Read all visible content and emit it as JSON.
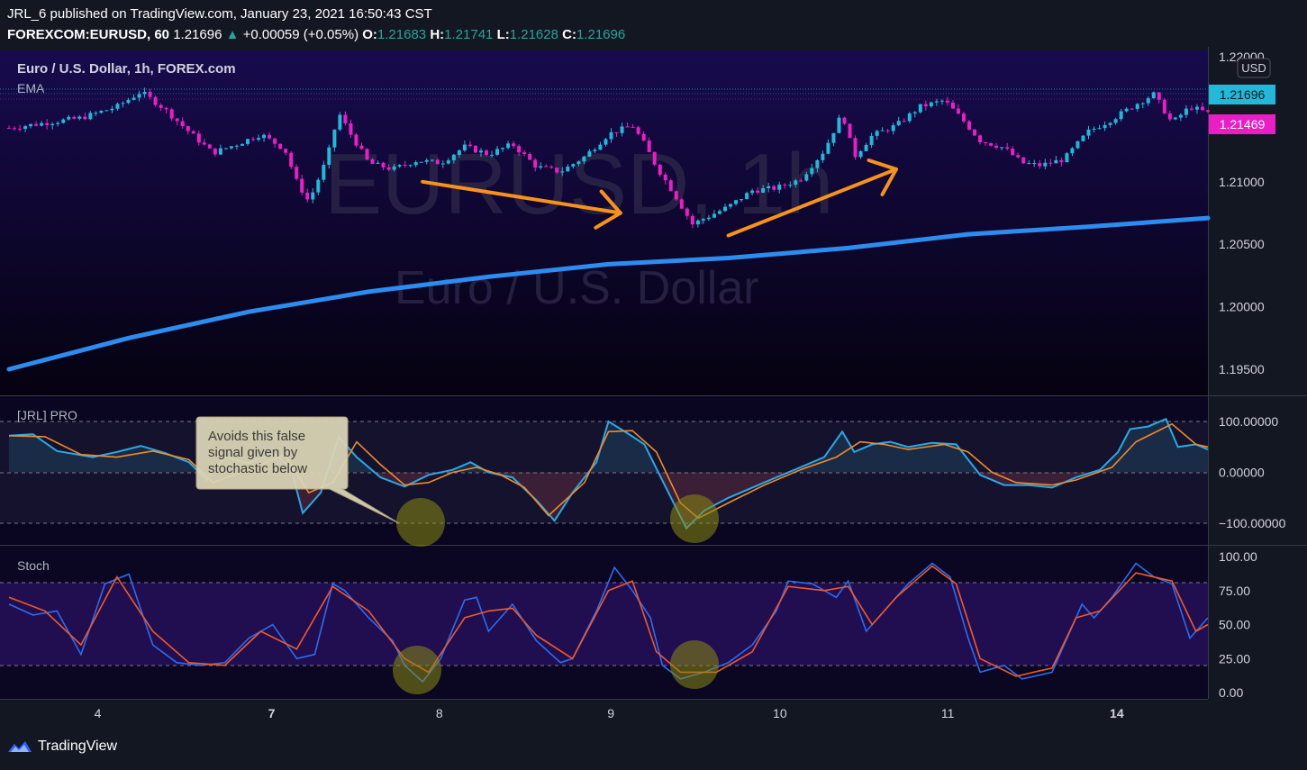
{
  "header": {
    "published_line": "JRL_6 published on TradingView.com, January 23, 2021 16:50:43 CST",
    "symbol": "FOREXCOM:EURUSD, 60",
    "last": "1.21696",
    "change": "+0.00059 (+0.05%)",
    "o_label": "O:",
    "o_val": "1.21683",
    "h_label": "H:",
    "h_val": "1.21741",
    "l_label": "L:",
    "l_val": "1.21628",
    "c_label": "C:",
    "c_val": "1.21696"
  },
  "colors": {
    "bg_dark": "#07051f",
    "bull": "#22b8d8",
    "bear": "#e91ec4",
    "ema": "#2d8cf0",
    "arrow": "#f7931a",
    "osc_fast": "#2aa9e6",
    "osc_slow": "#f28a2a",
    "stoch_k": "#2b6cf0",
    "stoch_d": "#f05a28"
  },
  "main_pane": {
    "title": "Euro / U.S. Dollar, 1h, FOREX.com",
    "indicator": "EMA",
    "watermark_big": "EURUSD, 1h",
    "watermark_small": "Euro / U.S. Dollar",
    "currency_button": "USD",
    "price_ticks": [
      "1.22000",
      "1.21000",
      "1.20500",
      "1.20000",
      "1.19500"
    ],
    "badge_current": "1.21696",
    "badge_marker": "1.21469"
  },
  "jrl_pane": {
    "title": "[JRL] PRO",
    "ticks": [
      "100.00000",
      "0.00000",
      "−100.00000"
    ],
    "callout": "Avoids this false signal given by stochastic below"
  },
  "stoch_pane": {
    "title": "Stoch",
    "ticks": [
      "100.00",
      "75.00",
      "50.00",
      "25.00",
      "0.00"
    ]
  },
  "time_axis": [
    "4",
    "7",
    "8",
    "9",
    "10",
    "11",
    "14"
  ],
  "footer": {
    "brand": "TradingView"
  },
  "chart_data": [
    {
      "type": "candlestick",
      "title": "Euro / U.S. Dollar, 1h, FOREX.com",
      "ylim": [
        1.1925,
        1.2205
      ],
      "x_labels": [
        "4",
        "7",
        "8",
        "9",
        "10",
        "11",
        "14"
      ],
      "price_path": [
        [
          0,
          1.2143
        ],
        [
          0.03,
          1.2147
        ],
        [
          0.06,
          1.2151
        ],
        [
          0.09,
          1.216
        ],
        [
          0.11,
          1.2172
        ],
        [
          0.13,
          1.2158
        ],
        [
          0.15,
          1.214
        ],
        [
          0.17,
          1.2123
        ],
        [
          0.19,
          1.213
        ],
        [
          0.21,
          1.2138
        ],
        [
          0.23,
          1.2126
        ],
        [
          0.24,
          1.21
        ],
        [
          0.25,
          1.2084
        ],
        [
          0.265,
          1.2118
        ],
        [
          0.275,
          1.2155
        ],
        [
          0.285,
          1.2138
        ],
        [
          0.3,
          1.2115
        ],
        [
          0.32,
          1.211
        ],
        [
          0.34,
          1.2117
        ],
        [
          0.36,
          1.2115
        ],
        [
          0.38,
          1.2128
        ],
        [
          0.4,
          1.2122
        ],
        [
          0.42,
          1.213
        ],
        [
          0.44,
          1.2112
        ],
        [
          0.46,
          1.2108
        ],
        [
          0.48,
          1.212
        ],
        [
          0.5,
          1.2138
        ],
        [
          0.52,
          1.2145
        ],
        [
          0.53,
          1.213
        ],
        [
          0.54,
          1.2112
        ],
        [
          0.555,
          1.209
        ],
        [
          0.57,
          1.2066
        ],
        [
          0.585,
          1.2073
        ],
        [
          0.6,
          1.208
        ],
        [
          0.62,
          1.2093
        ],
        [
          0.64,
          1.2095
        ],
        [
          0.66,
          1.2102
        ],
        [
          0.68,
          1.2125
        ],
        [
          0.695,
          1.2155
        ],
        [
          0.705,
          1.212
        ],
        [
          0.72,
          1.2137
        ],
        [
          0.74,
          1.2145
        ],
        [
          0.76,
          1.216
        ],
        [
          0.78,
          1.2165
        ],
        [
          0.795,
          1.215
        ],
        [
          0.81,
          1.2133
        ],
        [
          0.83,
          1.2127
        ],
        [
          0.845,
          1.2115
        ],
        [
          0.86,
          1.2113
        ],
        [
          0.88,
          1.2118
        ],
        [
          0.9,
          1.214
        ],
        [
          0.92,
          1.215
        ],
        [
          0.94,
          1.2162
        ],
        [
          0.955,
          1.217
        ],
        [
          0.97,
          1.2147
        ],
        [
          0.985,
          1.216
        ],
        [
          1,
          1.2155
        ]
      ],
      "annotation_arrow_1": {
        "from": [
          0.345,
          1.21
        ],
        "to": [
          0.51,
          1.2075
        ]
      },
      "annotation_arrow_2": {
        "from": [
          0.6,
          1.2057
        ],
        "to": [
          0.74,
          1.211
        ]
      }
    },
    {
      "type": "line",
      "name": "EMA",
      "ylim": [
        1.1925,
        1.2205
      ],
      "x": [
        0,
        0.1,
        0.2,
        0.3,
        0.4,
        0.5,
        0.6,
        0.7,
        0.8,
        0.9,
        1
      ],
      "y": [
        1.195,
        1.1975,
        1.1996,
        1.2012,
        1.2024,
        1.2034,
        1.2039,
        1.2047,
        1.2058,
        1.2064,
        1.2071
      ]
    },
    {
      "type": "line",
      "title": "[JRL] PRO",
      "ylim": [
        -120,
        120
      ],
      "levels": [
        100,
        0,
        -100
      ],
      "series": [
        {
          "values": [
            [
              0,
              72
            ],
            [
              0.02,
              75
            ],
            [
              0.04,
              42
            ],
            [
              0.07,
              30
            ],
            [
              0.09,
              40
            ],
            [
              0.11,
              52
            ],
            [
              0.13,
              38
            ],
            [
              0.15,
              20
            ],
            [
              0.165,
              -15
            ],
            [
              0.18,
              30
            ],
            [
              0.2,
              18
            ],
            [
              0.22,
              38
            ],
            [
              0.235,
              10
            ],
            [
              0.245,
              -80
            ],
            [
              0.26,
              -40
            ],
            [
              0.275,
              70
            ],
            [
              0.29,
              30
            ],
            [
              0.31,
              -10
            ],
            [
              0.33,
              -28
            ],
            [
              0.35,
              -5
            ],
            [
              0.37,
              5
            ],
            [
              0.385,
              20
            ],
            [
              0.4,
              0
            ],
            [
              0.42,
              -10
            ],
            [
              0.44,
              -55
            ],
            [
              0.455,
              -95
            ],
            [
              0.47,
              -40
            ],
            [
              0.49,
              20
            ],
            [
              0.5,
              100
            ],
            [
              0.515,
              78
            ],
            [
              0.53,
              55
            ],
            [
              0.55,
              -40
            ],
            [
              0.565,
              -110
            ],
            [
              0.58,
              -75
            ],
            [
              0.6,
              -50
            ],
            [
              0.62,
              -30
            ],
            [
              0.64,
              -10
            ],
            [
              0.66,
              10
            ],
            [
              0.68,
              30
            ],
            [
              0.695,
              80
            ],
            [
              0.705,
              40
            ],
            [
              0.72,
              55
            ],
            [
              0.735,
              60
            ],
            [
              0.75,
              50
            ],
            [
              0.77,
              58
            ],
            [
              0.79,
              55
            ],
            [
              0.81,
              -5
            ],
            [
              0.83,
              -25
            ],
            [
              0.85,
              -25
            ],
            [
              0.87,
              -30
            ],
            [
              0.89,
              -10
            ],
            [
              0.91,
              5
            ],
            [
              0.925,
              40
            ],
            [
              0.935,
              85
            ],
            [
              0.95,
              90
            ],
            [
              0.965,
              105
            ],
            [
              0.975,
              50
            ],
            [
              0.99,
              55
            ],
            [
              1,
              45
            ]
          ]
        },
        {
          "values": [
            [
              0,
              72
            ],
            [
              0.03,
              70
            ],
            [
              0.06,
              35
            ],
            [
              0.09,
              30
            ],
            [
              0.12,
              42
            ],
            [
              0.15,
              25
            ],
            [
              0.17,
              -20
            ],
            [
              0.2,
              5
            ],
            [
              0.23,
              35
            ],
            [
              0.25,
              -40
            ],
            [
              0.27,
              -20
            ],
            [
              0.29,
              60
            ],
            [
              0.31,
              15
            ],
            [
              0.33,
              -25
            ],
            [
              0.35,
              -20
            ],
            [
              0.37,
              0
            ],
            [
              0.39,
              10
            ],
            [
              0.41,
              -5
            ],
            [
              0.43,
              -30
            ],
            [
              0.45,
              -85
            ],
            [
              0.48,
              -20
            ],
            [
              0.5,
              80
            ],
            [
              0.52,
              82
            ],
            [
              0.54,
              40
            ],
            [
              0.56,
              -60
            ],
            [
              0.575,
              -90
            ],
            [
              0.6,
              -60
            ],
            [
              0.63,
              -25
            ],
            [
              0.66,
              5
            ],
            [
              0.69,
              30
            ],
            [
              0.71,
              60
            ],
            [
              0.73,
              55
            ],
            [
              0.75,
              45
            ],
            [
              0.78,
              55
            ],
            [
              0.8,
              40
            ],
            [
              0.82,
              0
            ],
            [
              0.84,
              -20
            ],
            [
              0.87,
              -25
            ],
            [
              0.89,
              -15
            ],
            [
              0.92,
              10
            ],
            [
              0.94,
              60
            ],
            [
              0.97,
              95
            ],
            [
              0.99,
              55
            ],
            [
              1,
              50
            ]
          ]
        }
      ]
    },
    {
      "type": "line",
      "title": "Stoch",
      "ylim": [
        0,
        100
      ],
      "levels": [
        80,
        20
      ],
      "series": [
        {
          "values": [
            [
              0,
              65
            ],
            [
              0.02,
              57
            ],
            [
              0.04,
              60
            ],
            [
              0.06,
              28
            ],
            [
              0.08,
              80
            ],
            [
              0.1,
              87
            ],
            [
              0.12,
              35
            ],
            [
              0.14,
              22
            ],
            [
              0.16,
              20
            ],
            [
              0.18,
              22
            ],
            [
              0.2,
              40
            ],
            [
              0.22,
              50
            ],
            [
              0.24,
              25
            ],
            [
              0.255,
              28
            ],
            [
              0.27,
              80
            ],
            [
              0.28,
              75
            ],
            [
              0.3,
              55
            ],
            [
              0.32,
              38
            ],
            [
              0.33,
              20
            ],
            [
              0.345,
              8
            ],
            [
              0.36,
              25
            ],
            [
              0.38,
              68
            ],
            [
              0.39,
              70
            ],
            [
              0.4,
              45
            ],
            [
              0.41,
              55
            ],
            [
              0.42,
              65
            ],
            [
              0.44,
              38
            ],
            [
              0.46,
              22
            ],
            [
              0.47,
              25
            ],
            [
              0.49,
              60
            ],
            [
              0.505,
              92
            ],
            [
              0.52,
              75
            ],
            [
              0.535,
              55
            ],
            [
              0.545,
              20
            ],
            [
              0.56,
              10
            ],
            [
              0.58,
              15
            ],
            [
              0.6,
              22
            ],
            [
              0.62,
              35
            ],
            [
              0.64,
              60
            ],
            [
              0.65,
              82
            ],
            [
              0.67,
              80
            ],
            [
              0.69,
              70
            ],
            [
              0.7,
              82
            ],
            [
              0.715,
              45
            ],
            [
              0.73,
              60
            ],
            [
              0.75,
              80
            ],
            [
              0.77,
              95
            ],
            [
              0.785,
              85
            ],
            [
              0.8,
              40
            ],
            [
              0.81,
              15
            ],
            [
              0.83,
              20
            ],
            [
              0.845,
              10
            ],
            [
              0.87,
              15
            ],
            [
              0.88,
              35
            ],
            [
              0.895,
              65
            ],
            [
              0.905,
              55
            ],
            [
              0.92,
              70
            ],
            [
              0.94,
              95
            ],
            [
              0.955,
              85
            ],
            [
              0.97,
              80
            ],
            [
              0.985,
              40
            ],
            [
              1,
              55
            ]
          ]
        },
        {
          "values": [
            [
              0,
              70
            ],
            [
              0.03,
              60
            ],
            [
              0.06,
              35
            ],
            [
              0.09,
              85
            ],
            [
              0.12,
              45
            ],
            [
              0.15,
              22
            ],
            [
              0.18,
              20
            ],
            [
              0.21,
              45
            ],
            [
              0.24,
              32
            ],
            [
              0.27,
              78
            ],
            [
              0.3,
              60
            ],
            [
              0.33,
              25
            ],
            [
              0.35,
              15
            ],
            [
              0.38,
              55
            ],
            [
              0.4,
              60
            ],
            [
              0.42,
              62
            ],
            [
              0.44,
              42
            ],
            [
              0.47,
              25
            ],
            [
              0.5,
              75
            ],
            [
              0.52,
              82
            ],
            [
              0.54,
              30
            ],
            [
              0.56,
              15
            ],
            [
              0.59,
              15
            ],
            [
              0.62,
              30
            ],
            [
              0.65,
              78
            ],
            [
              0.68,
              75
            ],
            [
              0.7,
              78
            ],
            [
              0.72,
              50
            ],
            [
              0.74,
              70
            ],
            [
              0.77,
              93
            ],
            [
              0.79,
              80
            ],
            [
              0.81,
              25
            ],
            [
              0.84,
              12
            ],
            [
              0.87,
              18
            ],
            [
              0.89,
              55
            ],
            [
              0.91,
              60
            ],
            [
              0.94,
              88
            ],
            [
              0.97,
              82
            ],
            [
              0.99,
              45
            ],
            [
              1,
              50
            ]
          ]
        }
      ]
    }
  ]
}
